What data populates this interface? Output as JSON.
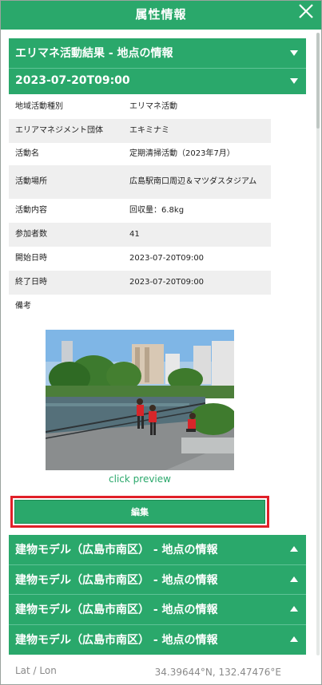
{
  "title_bar": {
    "title": "属性情報",
    "close_icon": "close-icon"
  },
  "accordion_top": {
    "label": "エリマネ活動結果 - 地点の情報",
    "state": "expanded"
  },
  "record_header": {
    "label": "2023-07-20T09:00",
    "state": "expanded"
  },
  "attributes": [
    {
      "key": "地域活動種別",
      "value": "エリマネ活動"
    },
    {
      "key": "エリアマネジメント団体",
      "value": "エキミナミ"
    },
    {
      "key": "活動名",
      "value": "定期清掃活動（2023年7月）"
    },
    {
      "key": "活動場所",
      "value": "広島駅南口周辺＆マツダスタジアム"
    },
    {
      "key": "活動内容",
      "value": "回収量：6.8kg"
    },
    {
      "key": "参加者数",
      "value": "41"
    },
    {
      "key": "開始日時",
      "value": "2023-07-20T09:00"
    },
    {
      "key": "終了日時",
      "value": "2023-07-20T09:00"
    },
    {
      "key": "備考",
      "value": ""
    }
  ],
  "photo": {
    "preview_label": "click preview"
  },
  "edit_button": {
    "label": "編集"
  },
  "building_sections": [
    {
      "label": "建物モデル（広島市南区） - 地点の情報",
      "state": "collapsed"
    },
    {
      "label": "建物モデル（広島市南区） - 地点の情報",
      "state": "collapsed"
    },
    {
      "label": "建物モデル（広島市南区） - 地点の情報",
      "state": "collapsed"
    },
    {
      "label": "建物モデル（広島市南区） - 地点の情報",
      "state": "collapsed"
    }
  ],
  "latlon": {
    "label": "Lat / Lon",
    "value": "34.39644°N, 132.47476°E"
  },
  "colors": {
    "accent": "#2aa86b",
    "highlight_border": "#e01f28",
    "row_alt": "#efefef"
  }
}
